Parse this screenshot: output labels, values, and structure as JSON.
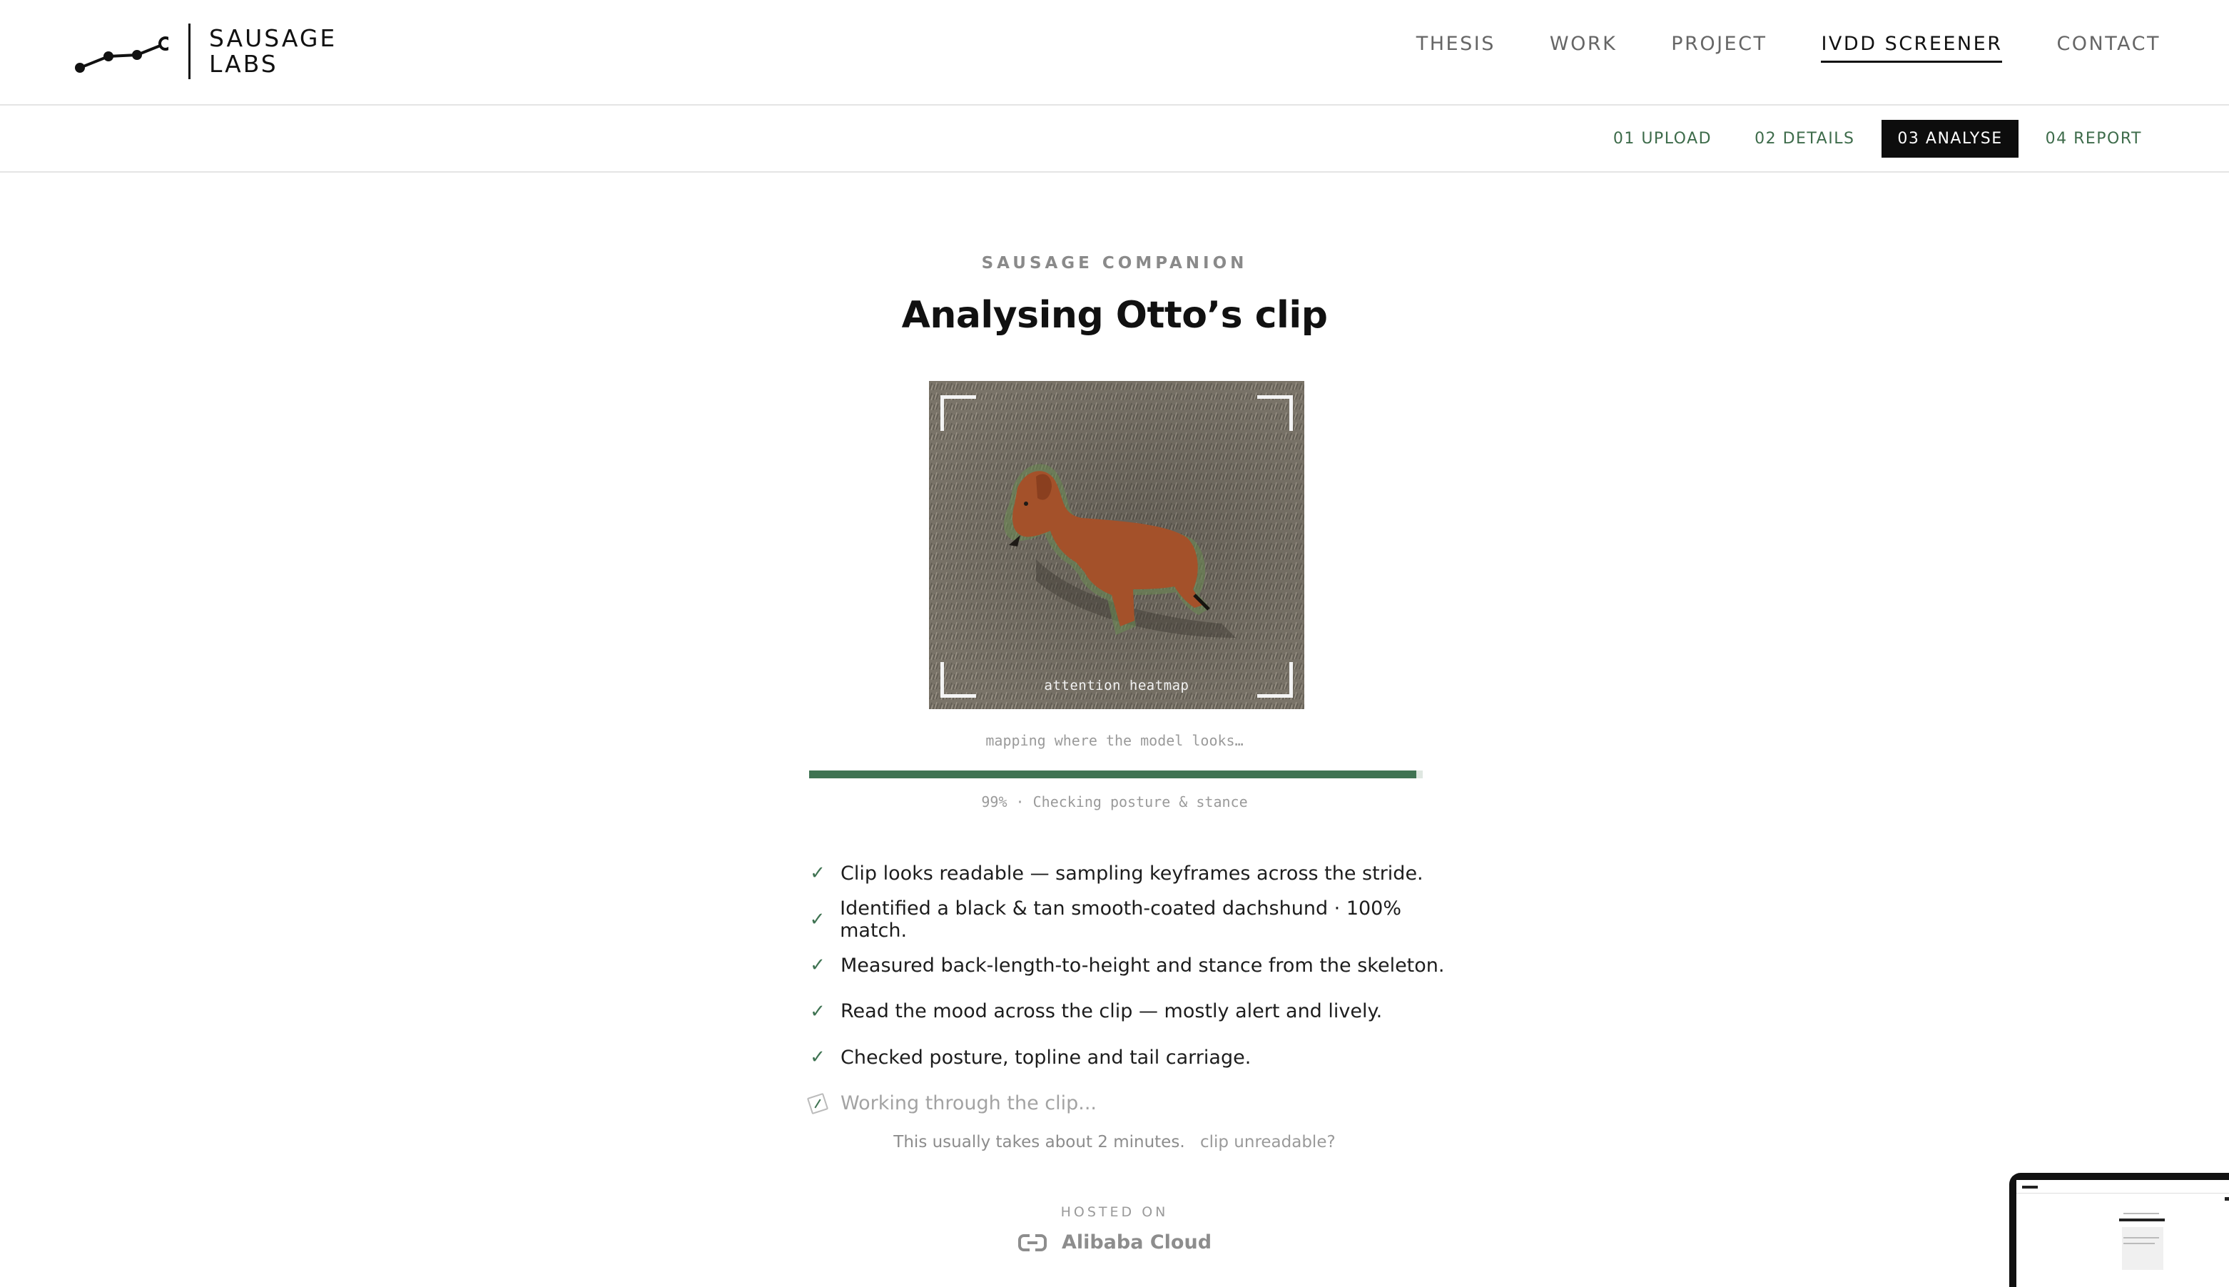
{
  "brand": {
    "name_line1": "SAUSAGE",
    "name_line2": "LABS"
  },
  "nav": {
    "items": [
      {
        "label": "THESIS",
        "active": false
      },
      {
        "label": "WORK",
        "active": false
      },
      {
        "label": "PROJECT",
        "active": false
      },
      {
        "label": "IVDD SCREENER",
        "active": true
      },
      {
        "label": "CONTACT",
        "active": false
      }
    ]
  },
  "steps": [
    {
      "label": "01 UPLOAD",
      "active": false
    },
    {
      "label": "02 DETAILS",
      "active": false
    },
    {
      "label": "03 ANALYSE",
      "active": true
    },
    {
      "label": "04 REPORT",
      "active": false
    }
  ],
  "main": {
    "eyebrow": "SAUSAGE COMPANION",
    "title": "Analysing Otto’s clip",
    "preview_caption": "attention heatmap",
    "status_note": "mapping where the model looks…",
    "progress_percent": 99,
    "progress_text": "99% · Checking posture & stance",
    "checklist": [
      {
        "text": "Clip looks readable — sampling keyframes across the stride.",
        "done": true
      },
      {
        "text": "Identified a black & tan smooth-coated dachshund · 100% match.",
        "done": true
      },
      {
        "text": "Measured back-length-to-height and stance from the skeleton.",
        "done": true
      },
      {
        "text": "Read the mood across the clip — mostly alert and lively.",
        "done": true
      },
      {
        "text": "Checked posture, topline and tail carriage.",
        "done": true
      },
      {
        "text": "Working through the clip...",
        "done": false
      }
    ],
    "duration_text": "This usually takes about 2 minutes.",
    "unreadable_link": "clip unreadable?"
  },
  "footer": {
    "hosted_label": "HOSTED ON",
    "hosted_brand": "Alibaba Cloud"
  },
  "colors": {
    "accent_green": "#3f7352",
    "active_step_bg": "#0d0d0d"
  },
  "icons": {
    "done": "checkmark-icon",
    "pending": "pending-spinner-icon",
    "host": "link-icon"
  }
}
